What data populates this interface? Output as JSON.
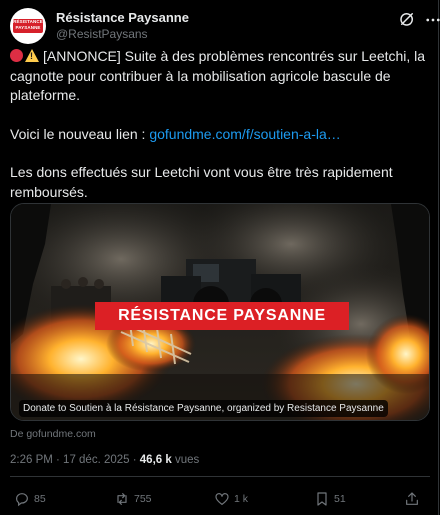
{
  "account": {
    "name": "Résistance Paysanne",
    "handle": "@ResistPaysans",
    "avatar_text_1": "RÉSISTANCE",
    "avatar_text_2": "PAYSANNE"
  },
  "post": {
    "line1": "[ANNONCE] Suite à des problèmes rencontrés sur Leetchi, la cagnotte pour contribuer à la mobilisation agricole bascule de plateforme.",
    "link_prefix": "Voici le nouveau lien : ",
    "link_text": "gofundme.com/f/soutien-a-la…",
    "line3": "Les dons effectués sur Leetchi vont vous être très rapidement remboursés."
  },
  "card": {
    "banner": "RÉSISTANCE PAYSANNE",
    "caption": "Donate to Soutien à la Résistance Paysanne, organized by Resistance Paysanne",
    "source": "De gofundme.com"
  },
  "meta": {
    "time": "2:26 PM · 17 déc. 2025 · ",
    "views": "46,6 k",
    "views_label": " vues"
  },
  "actions": {
    "replies": "85",
    "reposts": "755",
    "likes": "1 k",
    "bookmarks": "51"
  },
  "icons": [
    "grok-icon",
    "more-icon",
    "reply-icon",
    "repost-icon",
    "like-icon",
    "bookmark-icon",
    "share-icon"
  ],
  "colors": {
    "link": "#1d9bf0",
    "banner": "#dc2025",
    "muted": "#71767b",
    "text": "#e7e9ea"
  }
}
